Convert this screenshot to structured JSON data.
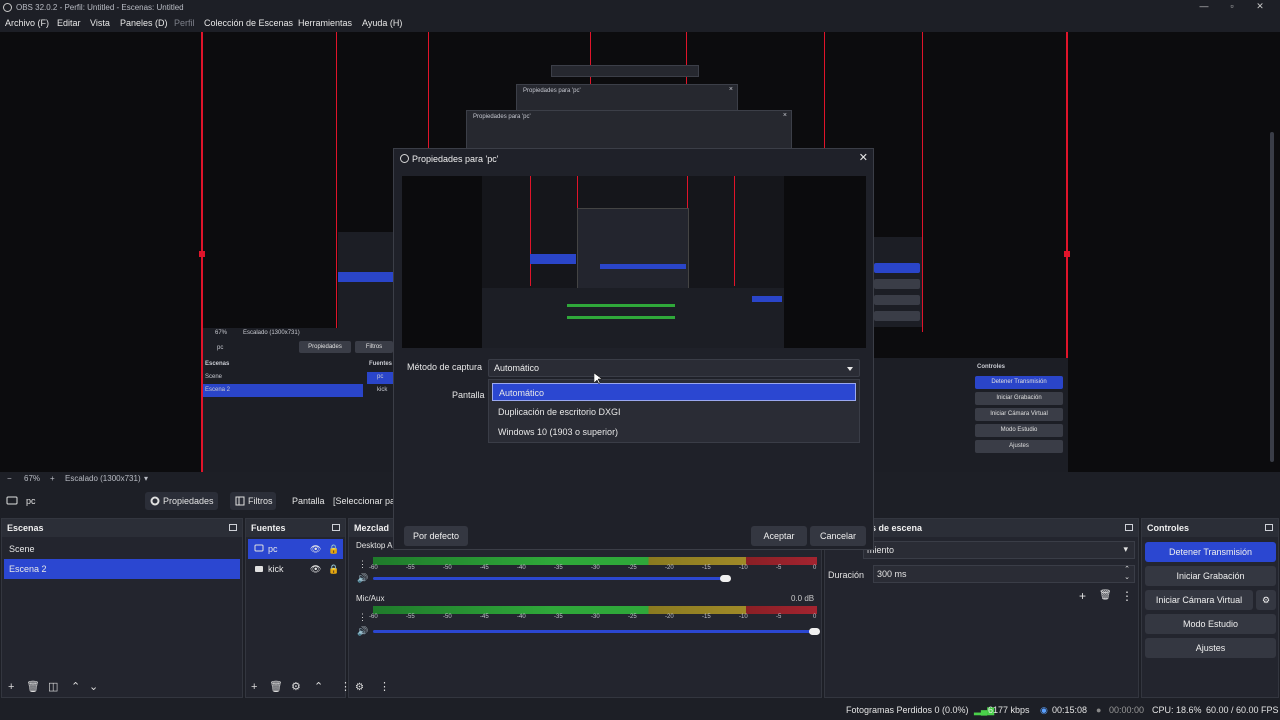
{
  "window": {
    "title": "OBS 32.0.2 - Perfil: Untitled - Escenas: Untitled"
  },
  "menu": [
    "Archivo (F)",
    "Editar",
    "Vista",
    "Paneles (D)",
    "Perfil",
    "Colección de Escenas",
    "Herramientas",
    "Ayuda (H)"
  ],
  "preview": {
    "ghost_titles": [
      "Propiedades para 'pc'",
      "Propiedades para 'pc'"
    ],
    "inner": {
      "zoom": "67%",
      "scale": "Escalado (1300x731)",
      "source": "pc",
      "props": "Propiedades",
      "filters": "Filtros",
      "scenes_header": "Escenas",
      "sources_header": "Fuentes",
      "scene1": "Scene",
      "scene2": "Escena 2",
      "src1": "pc",
      "src2": "kick",
      "controls_header": "Controles",
      "controls": [
        "Detener Transmisión",
        "Iniciar Grabación",
        "Iniciar Cámara Virtual",
        "Modo Estudio",
        "Ajustes"
      ]
    }
  },
  "zoombar": {
    "minus": "−",
    "zoom": "67%",
    "plus": "+",
    "scale": "Escalado (1300x731)"
  },
  "source_toolbar": {
    "source_name": "pc",
    "properties_label": "Propiedades",
    "filters_label": "Filtros",
    "screen_label": "Pantalla",
    "screen_value": "[Seleccionar pa"
  },
  "scenes": {
    "header": "Escenas",
    "items": [
      "Scene",
      "Escena 2"
    ],
    "selected": 1
  },
  "sources": {
    "header": "Fuentes",
    "items": [
      "pc",
      "kick"
    ],
    "selected": 0
  },
  "mixer": {
    "header": "Mezclad",
    "channels": [
      {
        "name": "Desktop Au",
        "db": "",
        "volume": 0.8
      },
      {
        "name": "Mic/Aux",
        "db": "0.0 dB",
        "volume": 1.0
      }
    ],
    "ticks": [
      "-60",
      "-55",
      "-50",
      "-45",
      "-40",
      "-35",
      "-30",
      "-25",
      "-20",
      "-15",
      "-10",
      "-5",
      "0"
    ]
  },
  "transitions": {
    "header": "s de escena",
    "type_value": "miento",
    "duration_label": "Duración",
    "duration_value": "300 ms"
  },
  "controls": {
    "header": "Controles",
    "stop_stream": "Detener Transmisión",
    "start_record": "Iniciar Grabación",
    "start_vcam": "Iniciar Cámara Virtual",
    "studio_mode": "Modo Estudio",
    "settings": "Ajustes"
  },
  "status": {
    "dropped": "Fotogramas Perdidos 0 (0.0%)",
    "bitrate": "6177 kbps",
    "stream_time": "00:15:08",
    "rec_time": "00:00:00",
    "cpu": "CPU: 18.6%",
    "fps": "60.00 / 60.00 FPS"
  },
  "dialog": {
    "title": "Propiedades para 'pc'",
    "capture_method_label": "Método de captura",
    "capture_method_value": "Automático",
    "screen_label": "Pantalla",
    "options": [
      "Automático",
      "Duplicación de escritorio DXGI",
      "Windows 10 (1903 o superior)"
    ],
    "selected_option": 0,
    "defaults_button": "Por defecto",
    "ok_button": "Aceptar",
    "cancel_button": "Cancelar"
  },
  "colors": {
    "accent": "#2b47d1",
    "background": "#1d1f26",
    "panel": "#23252e",
    "red_guides": "#e0142a"
  }
}
